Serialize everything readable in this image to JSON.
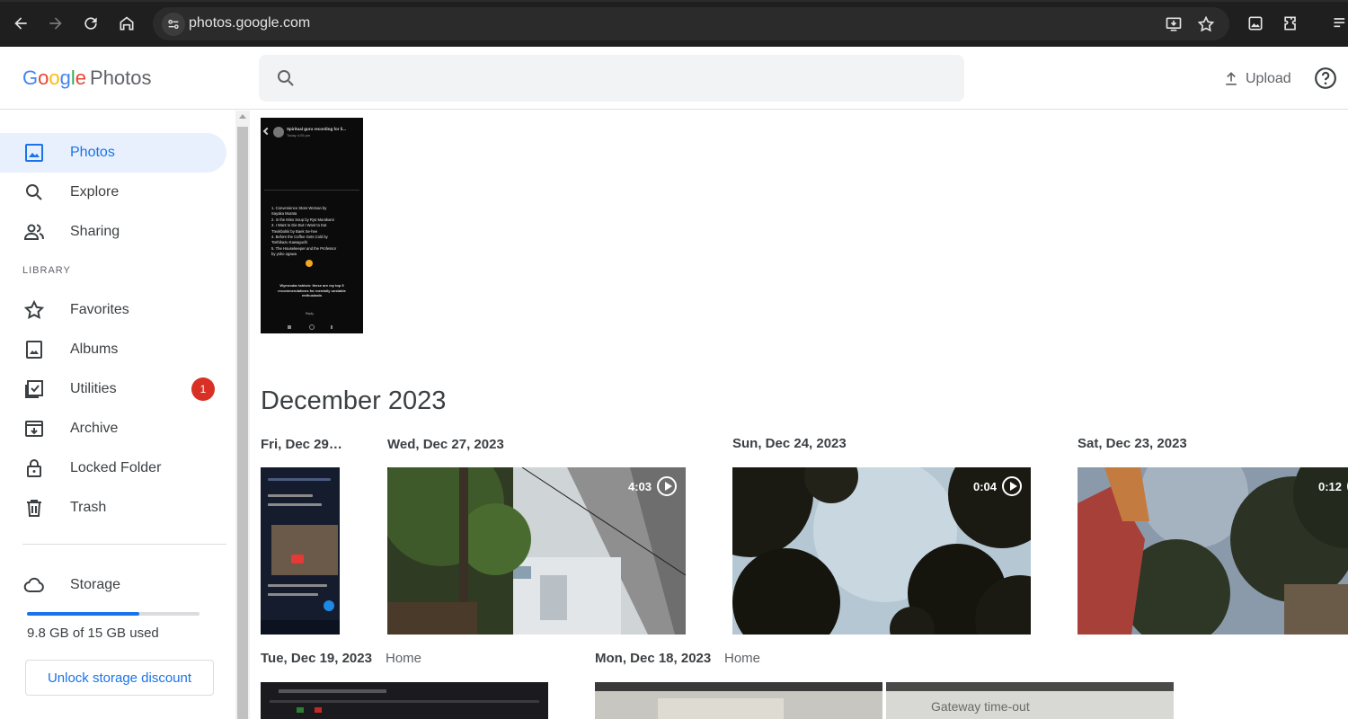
{
  "browser": {
    "url": "photos.google.com"
  },
  "header": {
    "logo_google": [
      "G",
      "o",
      "o",
      "g",
      "l",
      "e"
    ],
    "logo_product": "Photos",
    "search_placeholder": "",
    "upload_label": "Upload"
  },
  "sidebar": {
    "items": [
      {
        "label": "Photos",
        "icon": "photo-icon",
        "active": true
      },
      {
        "label": "Explore",
        "icon": "search-icon"
      },
      {
        "label": "Sharing",
        "icon": "people-icon"
      },
      {
        "label": "Favorites",
        "icon": "star-icon"
      },
      {
        "label": "Albums",
        "icon": "album-icon"
      },
      {
        "label": "Utilities",
        "icon": "utilities-icon",
        "badge": "1"
      },
      {
        "label": "Archive",
        "icon": "archive-icon"
      },
      {
        "label": "Locked Folder",
        "icon": "lock-icon"
      },
      {
        "label": "Trash",
        "icon": "trash-icon"
      },
      {
        "label": "Storage",
        "icon": "cloud-icon"
      }
    ],
    "library_label": "LIBRARY",
    "storage": {
      "used_text": "9.8 GB of 15 GB used",
      "used_fraction": 0.653
    },
    "unlock_label": "Unlock storage discount"
  },
  "main": {
    "month": "December 2023",
    "groups": [
      {
        "date": "Fri, Dec 29…"
      },
      {
        "date": "Wed, Dec 27, 2023",
        "duration": "4:03"
      },
      {
        "date": "Sun, Dec 24, 2023",
        "duration": "0:04"
      },
      {
        "date": "Sat, Dec 23, 2023",
        "duration": "0:12"
      },
      {
        "date": "Tue, Dec 19, 2023",
        "location": "Home"
      },
      {
        "date": "Mon, Dec 18, 2023",
        "location": "Home"
      }
    ],
    "screenshot_text": {
      "title": "Spiritual guru recording for li...",
      "subtitle": "Today 4:05 pm",
      "list": [
        "1.  Convenience Store Woman by",
        "     Sayaka Murata",
        "2.  In the Miso Soup by Ryū Murakami",
        "3.  I Want to Die But I Want to Eat",
        "     Tteokbokki by Baek Se-hee",
        "4.  Before the Coffee Gets Cold by",
        "     Toshikazu Kawaguchi",
        "5.  The Housekeeper and the Professor",
        "     by yoko ogawa"
      ],
      "footer": "Wymrodar tahisin: these are my top 5 recommendations for mentally unstable enthusiasts",
      "reply": "Reply"
    },
    "gateway_text": "Gateway time-out"
  },
  "colors": {
    "accent": "#1a73e8",
    "active_bg": "#e8f0fe",
    "badge": "#d93025"
  }
}
